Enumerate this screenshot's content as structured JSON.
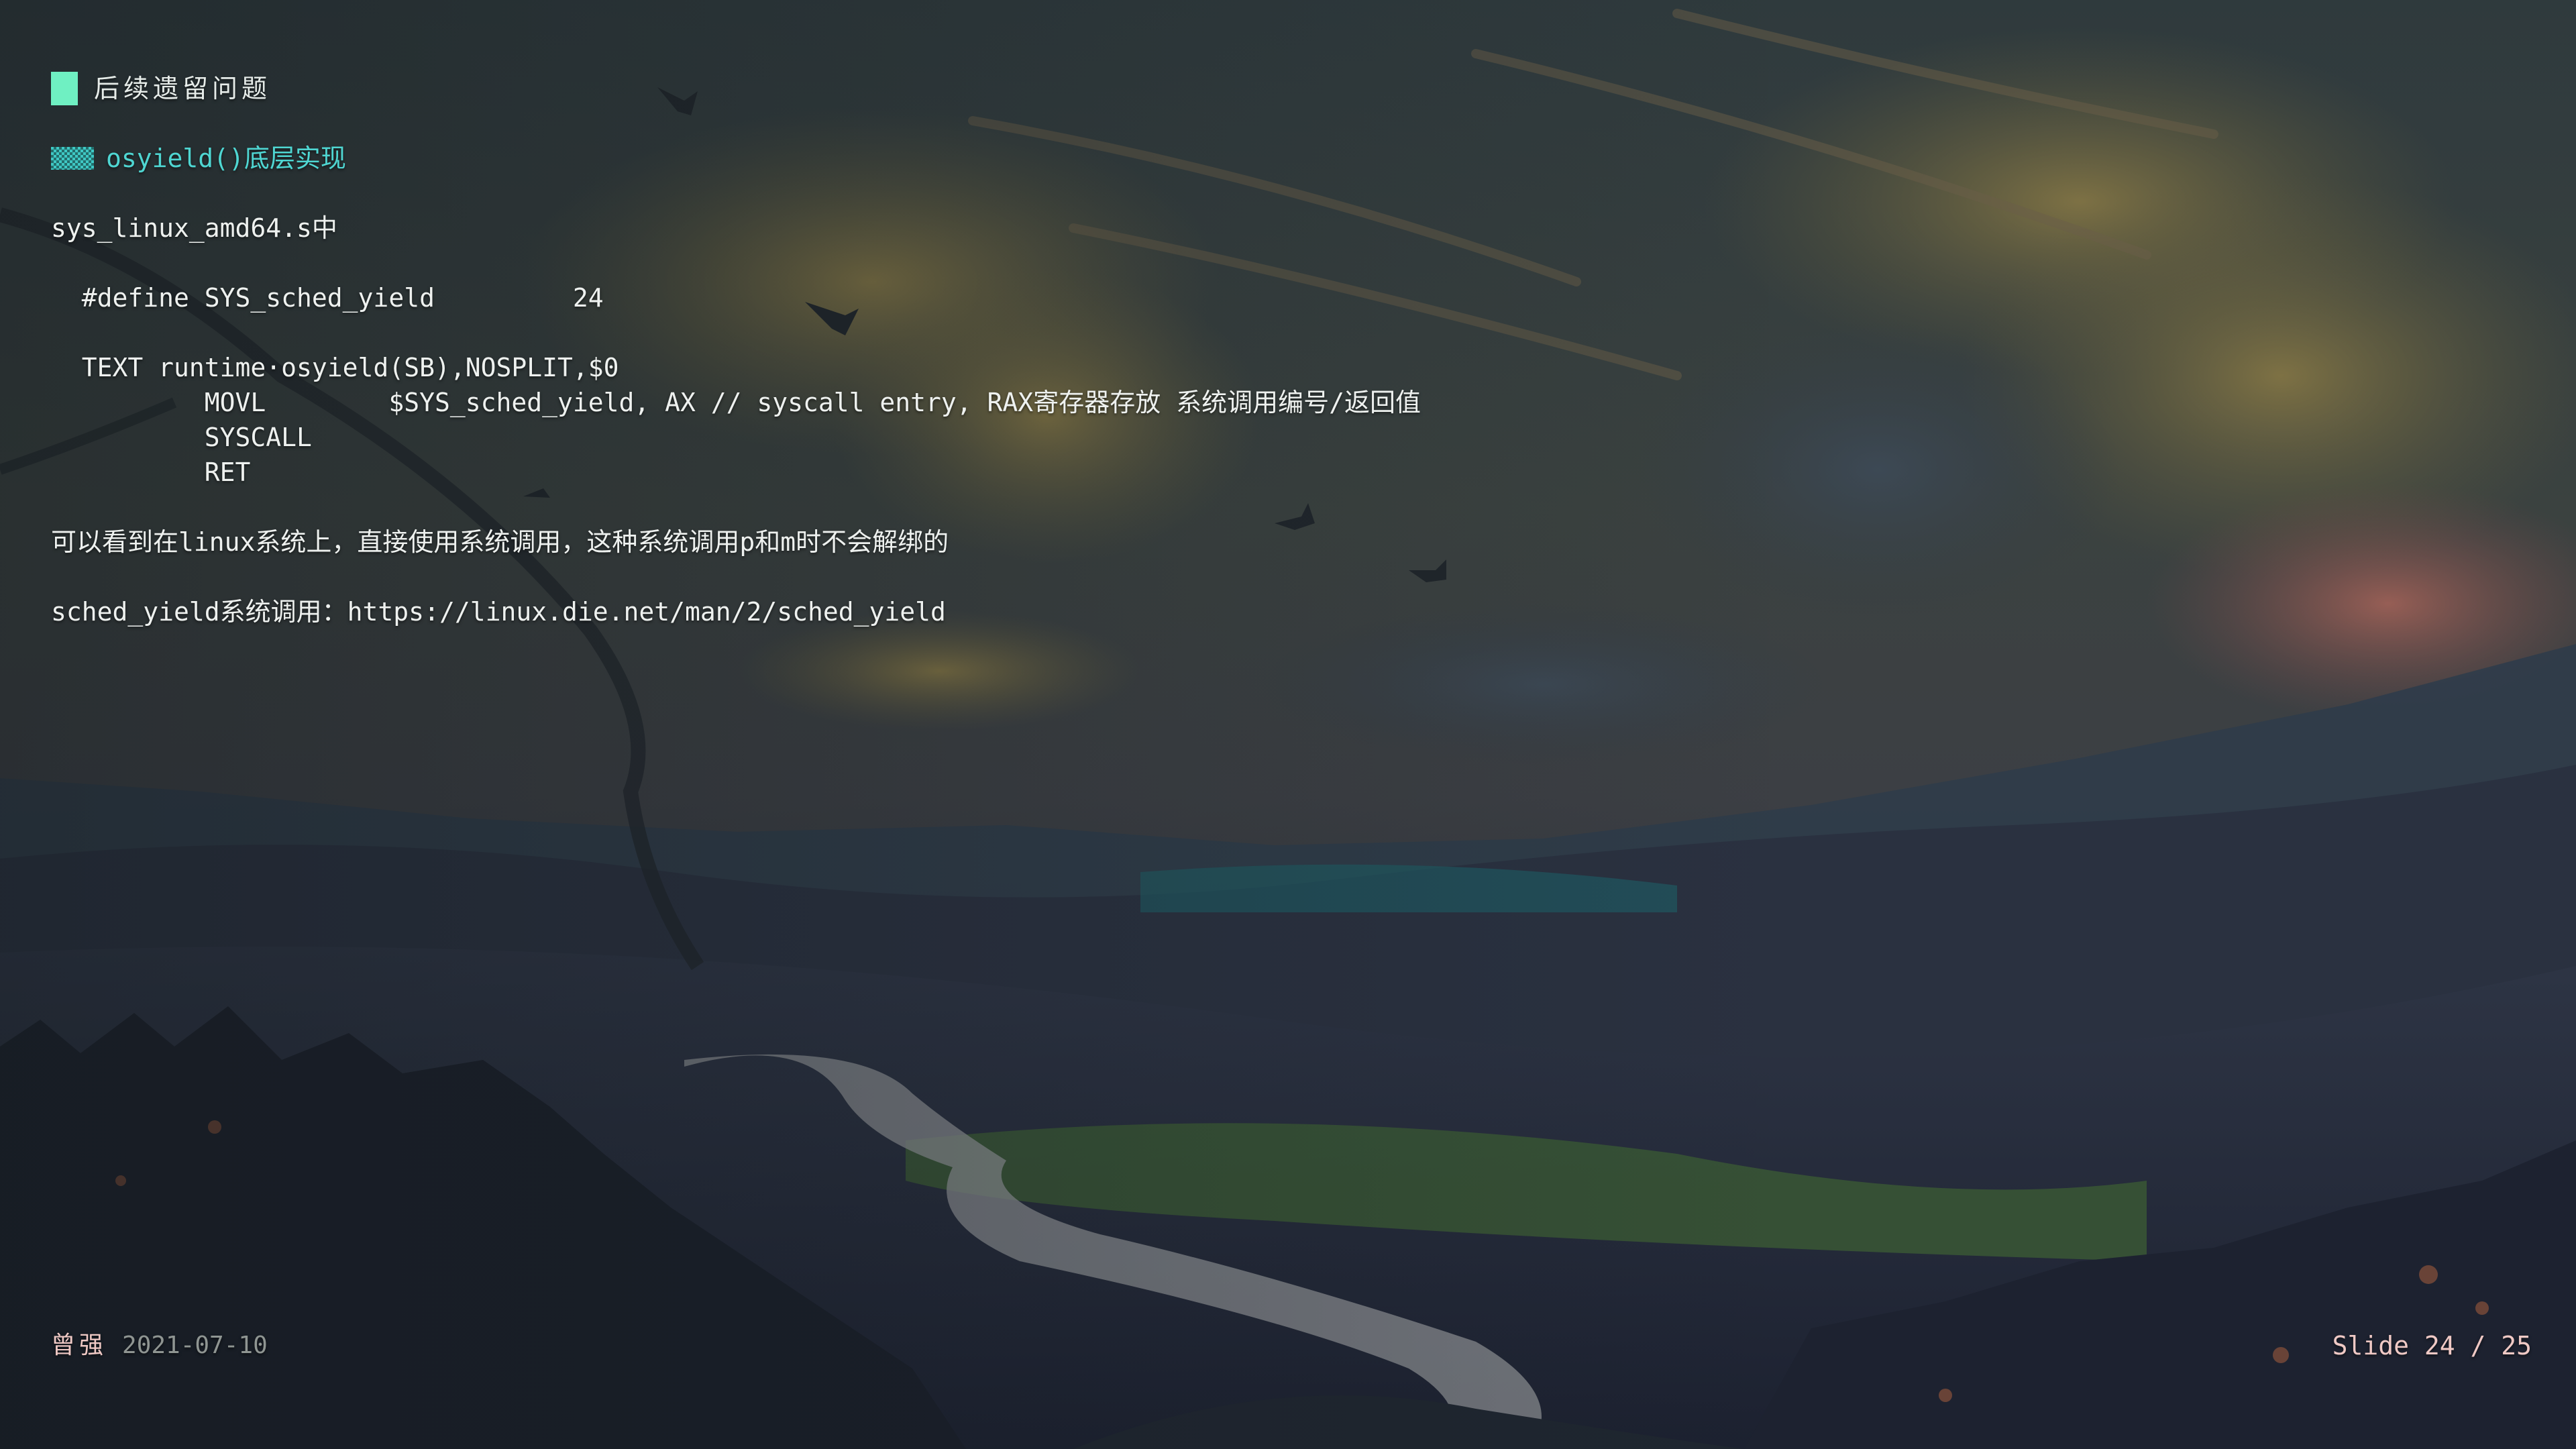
{
  "slide": {
    "heading": "后续遗留问题",
    "subheading_marker": "▓▓▓",
    "subheading": "osyield()底层实现",
    "intro": "sys_linux_amd64.s中",
    "code_define": "  #define SYS_sched_yield         24",
    "code_text": "  TEXT runtime·osyield(SB),NOSPLIT,$0",
    "code_movl": "          MOVL        $SYS_sched_yield, AX // syscall entry, RAX寄存器存放 系统调用编号/返回值",
    "code_syscall": "          SYSCALL",
    "code_ret": "          RET",
    "note": "可以看到在linux系统上，直接使用系统调用，这种系统调用p和m时不会解绑的",
    "ref_label": "sched_yield系统调用：",
    "ref_url": "https://linux.die.net/man/2/sched_yield"
  },
  "footer": {
    "author": "曾强",
    "date": "2021-07-10",
    "slide_counter": "Slide 24 / 25"
  },
  "colors": {
    "heading_marker": "#6ff0c2",
    "subheading": "#4fd6d2",
    "author": "#efc9c5",
    "date": "#8f9592",
    "slide_counter": "#efc9c5"
  }
}
